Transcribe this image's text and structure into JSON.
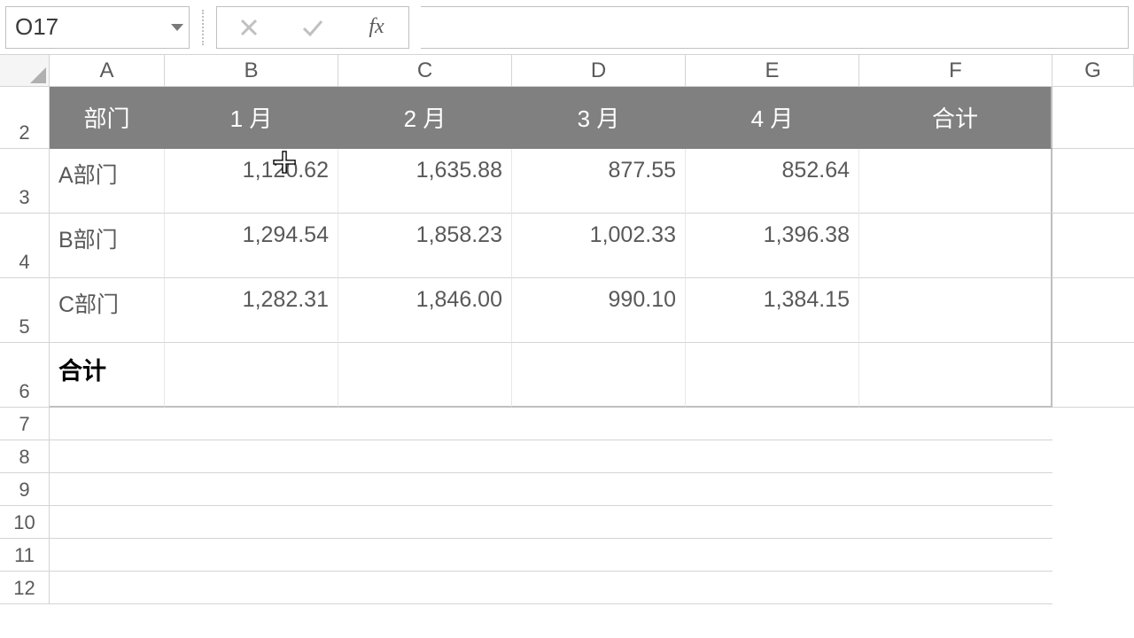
{
  "name_box": "O17",
  "fx_label": "fx",
  "columns": [
    "A",
    "B",
    "C",
    "D",
    "E",
    "F",
    "G"
  ],
  "row_numbers": [
    "2",
    "3",
    "4",
    "5",
    "6",
    "7",
    "8",
    "9",
    "10",
    "11",
    "12"
  ],
  "header_row": {
    "A": "部门",
    "B": "1 月",
    "C": "2 月",
    "D": "3 月",
    "E": "4 月",
    "F": "合计"
  },
  "data_rows": [
    {
      "A": "A部门",
      "B": "1,120.62",
      "C": "1,635.88",
      "D": "877.55",
      "E": "852.64",
      "F": ""
    },
    {
      "A": "B部门",
      "B": "1,294.54",
      "C": "1,858.23",
      "D": "1,002.33",
      "E": "1,396.38",
      "F": ""
    },
    {
      "A": "C部门",
      "B": "1,282.31",
      "C": "1,846.00",
      "D": "990.10",
      "E": "1,384.15",
      "F": ""
    }
  ],
  "total_row_label": "合计",
  "chart_data": {
    "type": "table",
    "title": "",
    "columns": [
      "部门",
      "1 月",
      "2 月",
      "3 月",
      "4 月",
      "合计"
    ],
    "rows": [
      {
        "部门": "A部门",
        "1 月": 1120.62,
        "2 月": 1635.88,
        "3 月": 877.55,
        "4 月": 852.64,
        "合计": null
      },
      {
        "部门": "B部门",
        "1 月": 1294.54,
        "2 月": 1858.23,
        "3 月": 1002.33,
        "4 月": 1396.38,
        "合计": null
      },
      {
        "部门": "C部门",
        "1 月": 1282.31,
        "2 月": 1846.0,
        "3 月": 990.1,
        "4 月": 1384.15,
        "合计": null
      },
      {
        "部门": "合计",
        "1 月": null,
        "2 月": null,
        "3 月": null,
        "4 月": null,
        "合计": null
      }
    ]
  }
}
